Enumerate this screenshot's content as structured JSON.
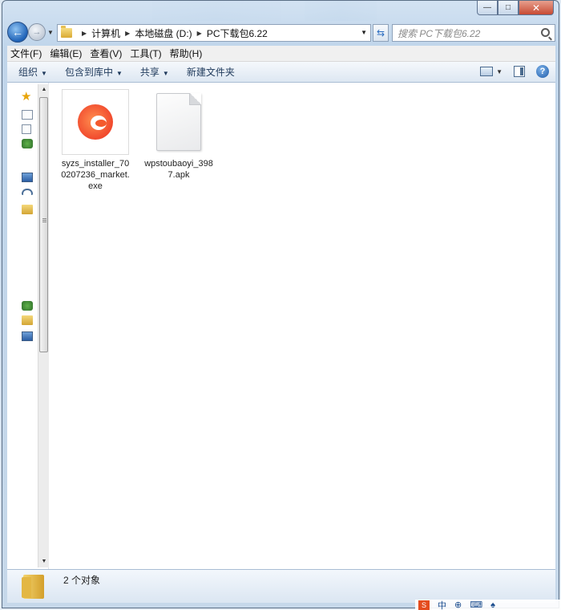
{
  "window": {
    "caption_buttons": {
      "minimize": "—",
      "maximize": "□",
      "close": "✕"
    }
  },
  "address": {
    "crumbs": [
      "计算机",
      "本地磁盘 (D:)",
      "PC下载包6.22"
    ],
    "search_placeholder": "搜索 PC下载包6.22"
  },
  "menubar": {
    "items": [
      "文件(F)",
      "编辑(E)",
      "查看(V)",
      "工具(T)",
      "帮助(H)"
    ]
  },
  "commandbar": {
    "items": [
      "组织",
      "包含到库中",
      "共享",
      "新建文件夹"
    ],
    "help_label": "?"
  },
  "files": [
    {
      "name": "syzs_installer_700207236_market.exe",
      "icon": "app-icon"
    },
    {
      "name": "wpstoubaoyi_3987.apk",
      "icon": "document-icon"
    }
  ],
  "status": {
    "count_text": "2 个对象"
  },
  "tray": {
    "items": [
      "中",
      "⊕",
      "⌨",
      "♠"
    ]
  },
  "colors": {
    "accent": "#1f63b8",
    "close": "#c74a33",
    "folder": "#d9aa33"
  }
}
